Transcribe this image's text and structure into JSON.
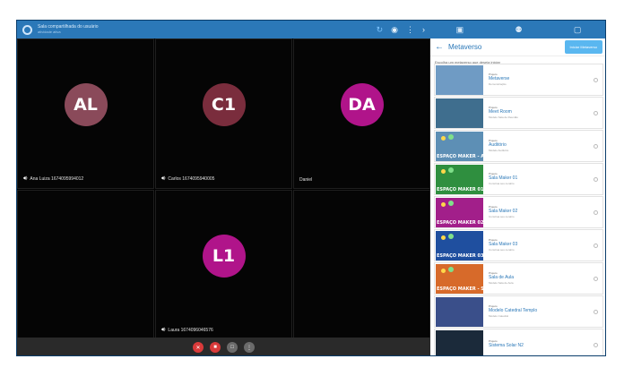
{
  "topbar": {
    "title": "Sala compartilhada do usuário",
    "subtitle": "atividade ativa",
    "tools": [
      "sync-icon",
      "eye-icon",
      "more-vert-icon",
      "chevron-right-icon"
    ]
  },
  "participants": [
    {
      "initials": "AL",
      "name": "Ana Luiza 1674095994012",
      "color": "#8a4a5a",
      "speaker": true
    },
    {
      "initials": "C1",
      "name": "Carlos 1674095940005",
      "color": "#7a2d3d",
      "speaker": true
    },
    {
      "initials": "DA",
      "name": "Daniel",
      "color": "#b0148a",
      "speaker": false
    },
    {
      "initials": "L1",
      "name": "Laura 1674096046576",
      "color": "#b0148a",
      "speaker": true
    }
  ],
  "controls": [
    "mic-off-icon",
    "camera-off-icon",
    "screen-share-icon",
    "more-icon"
  ],
  "panel": {
    "tabs": [
      "chat-icon",
      "people-icon",
      "apps-icon"
    ],
    "title": "Metaverso",
    "button": "Iniciar Metaverso",
    "subtitle": "Escolha um metaverso que deseja iniciar",
    "items": [
      {
        "type": "Projeto",
        "name": "Metaverse",
        "desc": "Demonstração",
        "caption": "",
        "bg": "#6f9bc4"
      },
      {
        "type": "Projeto",
        "name": "Meet Room",
        "desc": "Modelo Sala de Reunião",
        "caption": "",
        "bg": "#3f6e8e"
      },
      {
        "type": "Projeto",
        "name": "Auditório",
        "desc": "Modelo Auditório",
        "caption": "ESPAÇO MAKER - AUI",
        "bg": "#5d8fb5"
      },
      {
        "type": "Projeto",
        "name": "Sala Maker 01",
        "desc": "Construa seu cenário",
        "caption": "ESPAÇO MAKER 01",
        "bg": "#2f8f3f"
      },
      {
        "type": "Projeto",
        "name": "Sala Maker 02",
        "desc": "Construa seu cenário",
        "caption": "ESPAÇO MAKER 02",
        "bg": "#a21f8a"
      },
      {
        "type": "Projeto",
        "name": "Sala Maker 03",
        "desc": "Construa seu cenário",
        "caption": "ESPAÇO MAKER 03",
        "bg": "#1f4f9f"
      },
      {
        "type": "Projeto",
        "name": "Sala de Aula",
        "desc": "Modelo Sala de Aula",
        "caption": "ESPAÇO MAKER - SAL",
        "bg": "#d76a2a"
      },
      {
        "type": "Projeto",
        "name": "Modelo Catedral Templo",
        "desc": "Modelo Catedral",
        "caption": "",
        "bg": "#3a4f8a"
      },
      {
        "type": "Projeto",
        "name": "Sistema Solar N2",
        "desc": "",
        "caption": "",
        "bg": "#1b2a3a"
      }
    ]
  }
}
